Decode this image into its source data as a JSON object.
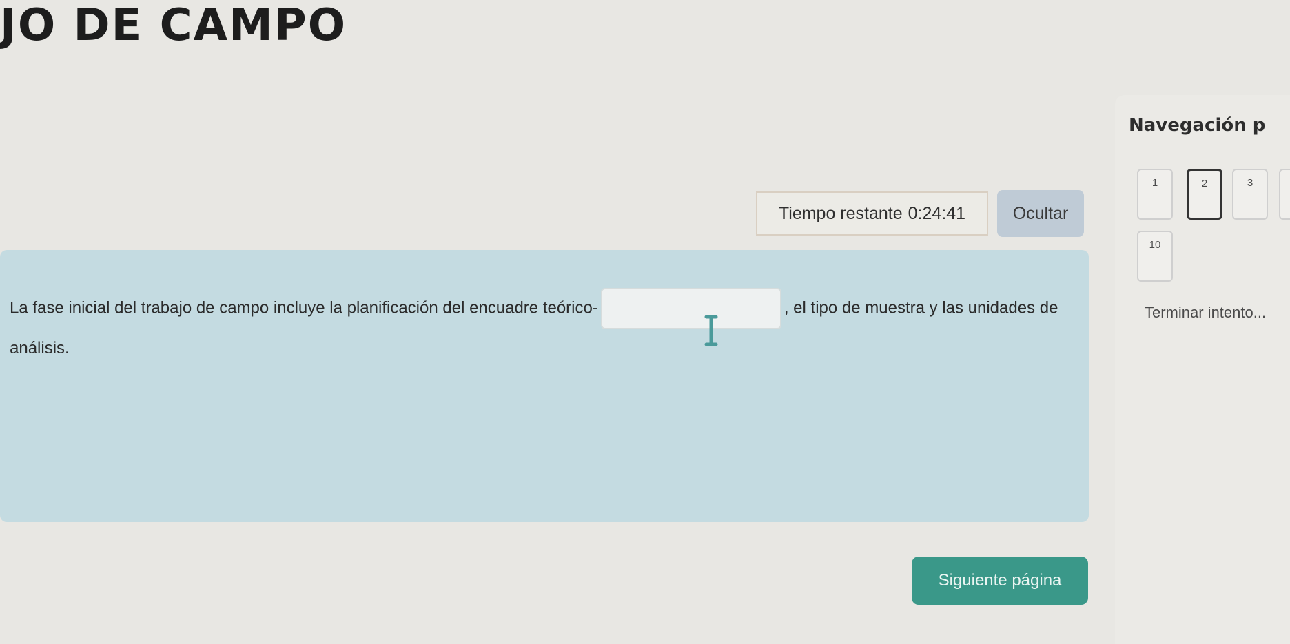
{
  "page": {
    "title": "JO DE CAMPO"
  },
  "timer": {
    "label": "Tiempo restante",
    "value": "0:24:41",
    "hide_label": "Ocultar"
  },
  "question": {
    "text_before": "La fase inicial del trabajo de campo incluye la planificación del encuadre teórico-",
    "input_value": "",
    "text_after": ", el tipo de muestra y las unidades de análisis."
  },
  "footer": {
    "next_label": "Siguiente página"
  },
  "navigation": {
    "title": "Navegación p",
    "buttons": [
      {
        "label": "1",
        "current": false
      },
      {
        "label": "2",
        "current": true
      },
      {
        "label": "3",
        "current": false
      },
      {
        "label": "",
        "current": false
      },
      {
        "label": "10",
        "current": false
      }
    ],
    "finish_label": "Terminar intento..."
  }
}
